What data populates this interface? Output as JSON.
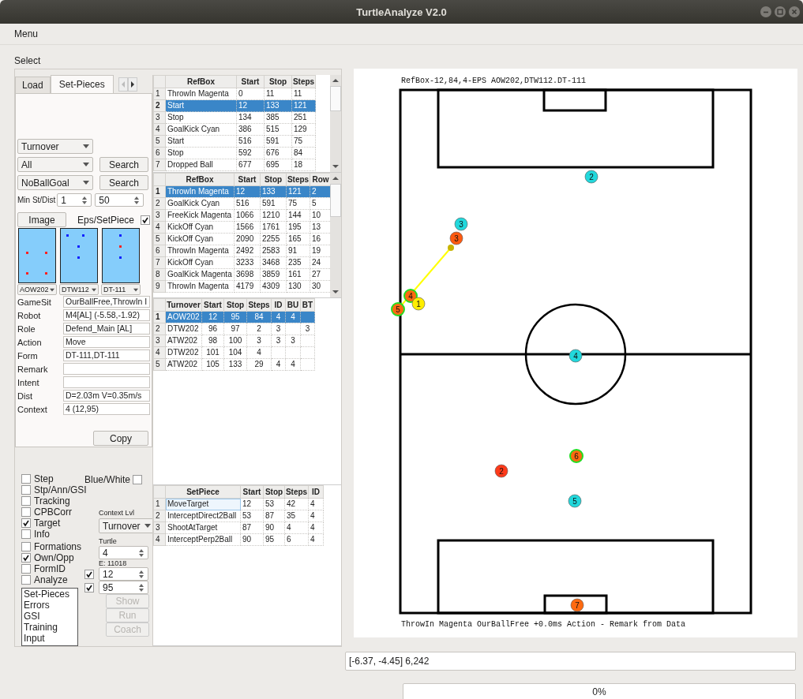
{
  "window": {
    "title": "TurtleAnalyze V2.0"
  },
  "menu": [
    "Menu"
  ],
  "section_title": "Select",
  "tabs": [
    {
      "label": "Load",
      "selected": false
    },
    {
      "label": "Set-Pieces",
      "selected": true
    }
  ],
  "filters": {
    "situation": "Turnover",
    "scope": "All",
    "goal_filter": "NoBallGoal",
    "search_buttons": [
      "Search",
      "Search"
    ],
    "min_label": "Min St/Dist",
    "min_steps": "1",
    "min_dist": "50",
    "image_button": "Image",
    "eps_label": "Eps/SetPiece",
    "eps_checked": true
  },
  "formations": [
    {
      "label": "AOW202"
    },
    {
      "label": "DTW112"
    },
    {
      "label": "DT-111"
    }
  ],
  "info": [
    {
      "label": "GameSit",
      "value": "OurBallFree,ThrowIn I"
    },
    {
      "label": "Robot",
      "value": "M4[AL] (-5.58,-1.92)"
    },
    {
      "label": "Role",
      "value": "Defend_Main [AL]"
    },
    {
      "label": "Action",
      "value": "Move"
    },
    {
      "label": "Form",
      "value": "DT-111,DT-111"
    },
    {
      "label": "Remark"
    },
    {
      "label": "Intent"
    },
    {
      "label": "Dist",
      "value": "D=2.03m V=0.35m/s"
    },
    {
      "label": "Context",
      "value": "4 (12,95)"
    }
  ],
  "copy_button": "Copy",
  "options": [
    {
      "label": "Step",
      "checked": false
    },
    {
      "label": "Stp/Ann/GSI",
      "checked": false
    },
    {
      "label": "Tracking",
      "checked": false
    },
    {
      "label": "CPBCorr",
      "checked": false
    },
    {
      "label": "Target",
      "checked": true
    },
    {
      "label": "Info",
      "checked": false
    },
    {
      "label": "Formations",
      "checked": false
    },
    {
      "label": "Own/Opp",
      "checked": true
    },
    {
      "label": "FormID",
      "checked": false
    },
    {
      "label": "Analyze",
      "checked": false
    }
  ],
  "blue_white": {
    "label": "Blue/White",
    "checked": false
  },
  "context": {
    "label": "Context Lvl",
    "value": "Turnover"
  },
  "turtle": {
    "label": "Turtle",
    "value": "4",
    "note": "E: 11018"
  },
  "range": [
    {
      "checked": true,
      "value": "12"
    },
    {
      "checked": true,
      "value": "95"
    }
  ],
  "modes": [
    "Set-Pieces",
    "Errors",
    "GSI",
    "Training",
    "Input"
  ],
  "actions": [
    {
      "label": "Show",
      "disabled": true
    },
    {
      "label": "Run",
      "disabled": true
    },
    {
      "label": "Coach",
      "disabled": true
    }
  ],
  "refbox_table": {
    "columns": [
      "RefBox",
      "Start",
      "Stop",
      "Steps"
    ],
    "rows": [
      {
        "n": "1",
        "cells": [
          "ThrowIn Magenta",
          "0",
          "11",
          "11"
        ],
        "selected": false
      },
      {
        "n": "2",
        "cells": [
          "Start",
          "12",
          "133",
          "121"
        ],
        "selected": true
      },
      {
        "n": "3",
        "cells": [
          "Stop",
          "134",
          "385",
          "251"
        ],
        "selected": false
      },
      {
        "n": "4",
        "cells": [
          "GoalKick Cyan",
          "386",
          "515",
          "129"
        ],
        "selected": false
      },
      {
        "n": "5",
        "cells": [
          "Start",
          "516",
          "591",
          "75"
        ],
        "selected": false
      },
      {
        "n": "6",
        "cells": [
          "Stop",
          "592",
          "676",
          "84"
        ],
        "selected": false
      },
      {
        "n": "7",
        "cells": [
          "Dropped Ball",
          "677",
          "695",
          "18"
        ],
        "selected": false
      }
    ]
  },
  "setpiece_table": {
    "columns": [
      "RefBox",
      "Start",
      "Stop",
      "Steps",
      "Row"
    ],
    "rows": [
      {
        "n": "1",
        "cells": [
          "ThrowIn Magenta",
          "12",
          "133",
          "121",
          "2"
        ],
        "selected": true
      },
      {
        "n": "2",
        "cells": [
          "GoalKick Cyan",
          "516",
          "591",
          "75",
          "5"
        ],
        "selected": false
      },
      {
        "n": "3",
        "cells": [
          "FreeKick Magenta",
          "1066",
          "1210",
          "144",
          "10"
        ],
        "selected": false
      },
      {
        "n": "4",
        "cells": [
          "KickOff Cyan",
          "1566",
          "1761",
          "195",
          "13"
        ],
        "selected": false
      },
      {
        "n": "5",
        "cells": [
          "KickOff Cyan",
          "2090",
          "2255",
          "165",
          "16"
        ],
        "selected": false
      },
      {
        "n": "6",
        "cells": [
          "ThrowIn Magenta",
          "2492",
          "2583",
          "91",
          "19"
        ],
        "selected": false
      },
      {
        "n": "7",
        "cells": [
          "KickOff Cyan",
          "3233",
          "3468",
          "235",
          "24"
        ],
        "selected": false
      },
      {
        "n": "8",
        "cells": [
          "GoalKick Magenta",
          "3698",
          "3859",
          "161",
          "27"
        ],
        "selected": false
      },
      {
        "n": "9",
        "cells": [
          "ThrowIn Magenta",
          "4179",
          "4309",
          "130",
          "30"
        ],
        "selected": false
      }
    ]
  },
  "turnover_table": {
    "columns": [
      "Turnover",
      "Start",
      "Stop",
      "Steps",
      "ID",
      "BU",
      "BT"
    ],
    "rows": [
      {
        "n": "1",
        "cells": [
          "AOW202",
          "12",
          "95",
          "84",
          "4",
          "4",
          null
        ],
        "selected": true
      },
      {
        "n": "2",
        "cells": [
          "DTW202",
          "96",
          "97",
          "2",
          "3",
          null,
          "3"
        ],
        "selected": false
      },
      {
        "n": "3",
        "cells": [
          "ATW202",
          "98",
          "100",
          "3",
          "3",
          "3",
          null
        ],
        "selected": false
      },
      {
        "n": "4",
        "cells": [
          "DTW202",
          "101",
          "104",
          "4",
          null,
          null,
          null
        ],
        "selected": false
      },
      {
        "n": "5",
        "cells": [
          "ATW202",
          "105",
          "133",
          "29",
          "4",
          "4",
          null
        ],
        "selected": false
      }
    ]
  },
  "action_table": {
    "columns": [
      "SetPiece",
      "Start",
      "Stop",
      "Steps",
      "ID"
    ],
    "rows": [
      {
        "n": "1",
        "cells": [
          "MoveTarget",
          "12",
          "53",
          "42",
          "4"
        ],
        "selected": false,
        "focused": true
      },
      {
        "n": "2",
        "cells": [
          "InterceptDirect2Ball",
          "53",
          "87",
          "35",
          "4"
        ],
        "selected": false,
        "focused": false
      },
      {
        "n": "3",
        "cells": [
          "ShootAtTarget",
          "87",
          "90",
          "4",
          "4"
        ],
        "selected": false,
        "focused": false
      },
      {
        "n": "4",
        "cells": [
          "InterceptPerp2Ball",
          "90",
          "95",
          "6",
          "4"
        ],
        "selected": false,
        "focused": false
      }
    ]
  },
  "field": {
    "header": "RefBox-12,84,4-EPS AOW202,DTW112.DT-111",
    "footer": "ThrowIn Magenta OurBallFree +0.0ms Action - Remark from Data",
    "robots": [
      {
        "number": "2",
        "color": "#22d8dc",
        "highlighted": false
      },
      {
        "number": "3",
        "color": "#22d8dc",
        "highlighted": false
      },
      {
        "number": "3",
        "color": "#ff5a10",
        "highlighted": false
      },
      {
        "number": "4",
        "color": "#ff6a10",
        "highlighted": true
      },
      {
        "number": "1",
        "color": "#ffee00",
        "highlighted": false
      },
      {
        "number": "5",
        "color": "#ff6a10",
        "highlighted": true
      },
      {
        "number": "4",
        "color": "#22d8dc",
        "highlighted": false
      },
      {
        "number": "6",
        "color": "#ff6a10",
        "highlighted": true
      },
      {
        "number": "2",
        "color": "#ff3a1a",
        "highlighted": false
      },
      {
        "number": "5",
        "color": "#22d8dc",
        "highlighted": false
      },
      {
        "number": "7",
        "color": "#ff6a10",
        "highlighted": false
      }
    ]
  },
  "cursor_info": "[-6.37, -4.45] 6,242",
  "progress": {
    "label": "0%",
    "level": 0
  }
}
